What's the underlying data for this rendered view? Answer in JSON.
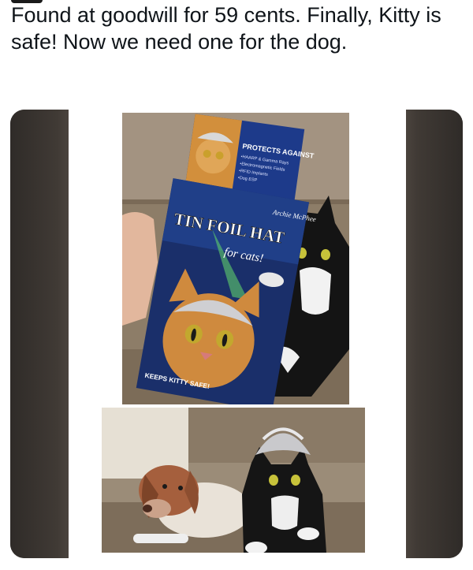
{
  "post": {
    "text": "Found at goodwill for 59 cents. Finally, Kitty is safe! Now we need one for the dog."
  },
  "product_box_back": {
    "heading": "PROTECTS AGAINST",
    "items": [
      "•HAARP & Gamma Rays",
      "•Electromagnetic Fields",
      "•RFID Implants",
      "•Dog ESP"
    ]
  },
  "product_box_front": {
    "brand": "Archie McPhee",
    "title": "TIN FOIL HAT",
    "subtitle": "for cats!",
    "tagline": "KEEPS KITTY SAFE!"
  }
}
